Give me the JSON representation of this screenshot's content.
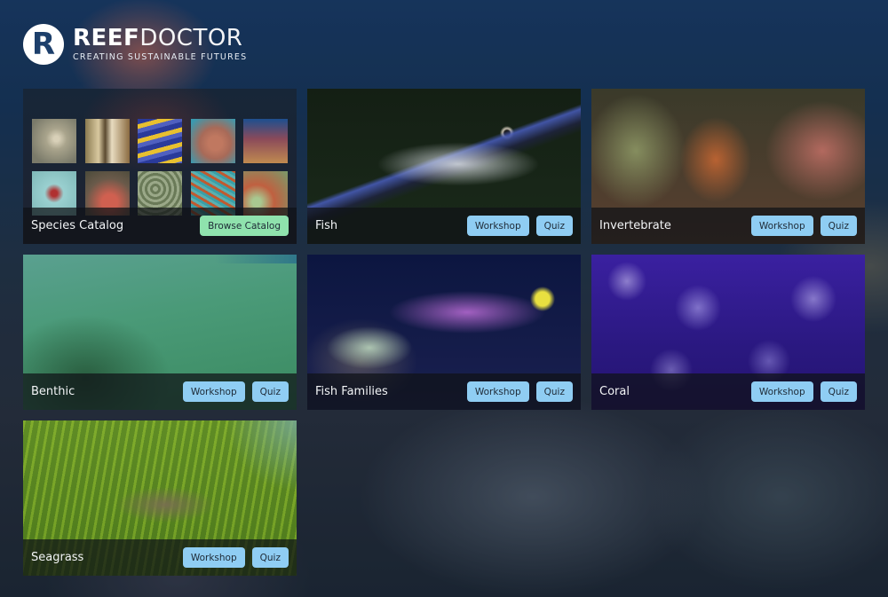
{
  "brand": {
    "logo_letter": "R",
    "name_bold": "REEF",
    "name_light": "DOCTOR",
    "tagline": "CREATING SUSTAINABLE FUTURES"
  },
  "catalog": {
    "label": "Species Catalog",
    "button": "Browse Catalog",
    "thumbnails": [
      "sand-fish",
      "butterflyfish",
      "yellow-striped-fish",
      "octopus",
      "reef-scene",
      "starfish",
      "sponge",
      "brain-coral",
      "anemone-textured",
      "clownfish-anemone"
    ]
  },
  "modules": [
    {
      "label": "Fish",
      "workshop": "Workshop",
      "quiz": "Quiz",
      "photo": "cleaner-wrasse"
    },
    {
      "label": "Invertebrate",
      "workshop": "Workshop",
      "quiz": "Quiz",
      "photo": "mantis-shrimp"
    },
    {
      "label": "Benthic",
      "workshop": "Workshop",
      "quiz": "Quiz",
      "photo": "brain-coral-closeup"
    },
    {
      "label": "Fish Families",
      "workshop": "Workshop",
      "quiz": "Quiz",
      "photo": "firefish-goby"
    },
    {
      "label": "Coral",
      "workshop": "Workshop",
      "quiz": "Quiz",
      "photo": "purple-coral"
    },
    {
      "label": "Seagrass",
      "workshop": "Workshop",
      "quiz": "Quiz",
      "photo": "blue-crab-seagrass"
    }
  ],
  "colors": {
    "workshop_quiz_button": "#8fcdf3",
    "browse_button": "#8fe2ad",
    "label_bar": "#0f1216",
    "logo_navy": "#1d3f6b"
  }
}
